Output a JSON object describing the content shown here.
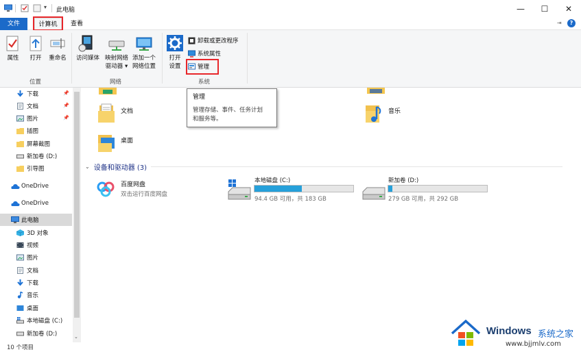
{
  "window": {
    "title": "此电脑",
    "min_label": "—",
    "max_label": "☐",
    "close_label": "✕"
  },
  "tabs": {
    "file": "文件",
    "computer": "计算机",
    "view": "查看"
  },
  "ribbon": {
    "location": {
      "label": "位置",
      "properties": "属性",
      "open": "打开",
      "rename": "重命名"
    },
    "network": {
      "label": "网络",
      "access_media": "访问媒体",
      "map_drive_1": "映射网络",
      "map_drive_2": "驱动器 ▾",
      "add_location_1": "添加一个",
      "add_location_2": "网络位置"
    },
    "system": {
      "label": "系统",
      "open_settings_1": "打开",
      "open_settings_2": "设置",
      "uninstall": "卸载或更改程序",
      "system_properties": "系统属性",
      "manage": "管理"
    }
  },
  "tooltip": {
    "title": "管理",
    "desc_1": "管理存储、事件、任务计划",
    "desc_2": "和服务等。"
  },
  "nav": {
    "quick": [
      {
        "label": "下载",
        "pinned": true
      },
      {
        "label": "文档",
        "pinned": true
      },
      {
        "label": "图片",
        "pinned": true
      },
      {
        "label": "插图",
        "pinned": false
      },
      {
        "label": "屏幕截图",
        "pinned": false
      },
      {
        "label": "新加卷 (D:)",
        "pinned": false
      },
      {
        "label": "引导图",
        "pinned": false
      }
    ],
    "onedrive_1": "OneDrive",
    "onedrive_2": "OneDrive",
    "this_pc": "此电脑",
    "pc_items": [
      "3D 对象",
      "视频",
      "图片",
      "文档",
      "下载",
      "音乐",
      "桌面",
      "本地磁盘 (C:)",
      "新加卷 (D:)"
    ]
  },
  "main": {
    "folders": {
      "documents": "文档",
      "music": "音乐",
      "desktop": "桌面"
    },
    "section_title": "设备和驱动器 (3)",
    "baidu": {
      "name": "百度网盘",
      "sub": "双击运行百度网盘"
    },
    "drive_c": {
      "name": "本地磁盘 (C:)",
      "info": "94.4 GB 可用，共 183 GB",
      "used_fraction": 0.48
    },
    "drive_d": {
      "name": "新加卷 (D:)",
      "info": "279 GB 可用，共 292 GB",
      "used_fraction": 0.045
    }
  },
  "status": {
    "items": "10 个项目"
  },
  "watermark": {
    "brand": "Windows",
    "cn": "系统之家",
    "url": "www.bjjmlv.com"
  },
  "colors": {
    "accent": "#1b6ac9",
    "highlight": "#e8262a",
    "drive_fill": "#26a0da"
  }
}
